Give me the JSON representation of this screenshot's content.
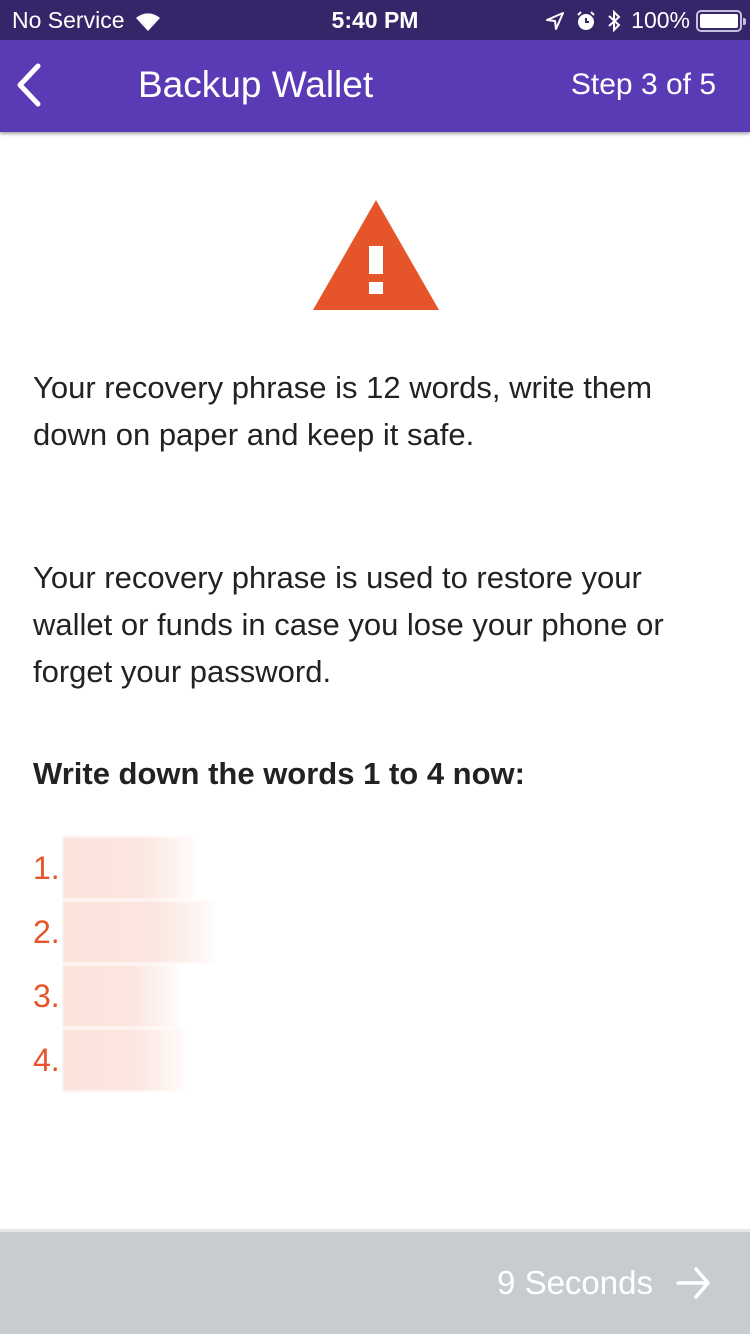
{
  "status_bar": {
    "carrier": "No Service",
    "time": "5:40 PM",
    "battery": "100%",
    "icons": [
      "wifi-icon",
      "location-icon",
      "alarm-icon",
      "bluetooth-icon",
      "battery-icon"
    ]
  },
  "nav": {
    "back_icon": "chevron-left-icon",
    "title": "Backup Wallet",
    "step": "Step 3 of 5"
  },
  "content": {
    "warning_icon": "warning-triangle-icon",
    "paragraph1": "Your recovery phrase is 12 words, write them down on paper and keep it safe.",
    "paragraph2": "Your recovery phrase is used to restore your wallet or funds in case you lose your phone or forget your password.",
    "heading": "Write down the words 1 to 4 now:",
    "words": [
      {
        "number": "1.",
        "hidden": true
      },
      {
        "number": "2.",
        "hidden": true
      },
      {
        "number": "3.",
        "hidden": true
      },
      {
        "number": "4.",
        "hidden": true
      }
    ]
  },
  "footer": {
    "countdown_label": "9 Seconds",
    "arrow_icon": "arrow-right-icon",
    "enabled": false
  },
  "colors": {
    "status_bar": "#352569",
    "nav_bar": "#5b3bb5",
    "accent": "#e5542b",
    "footer_disabled": "#c7cccf",
    "text": "#222222"
  }
}
